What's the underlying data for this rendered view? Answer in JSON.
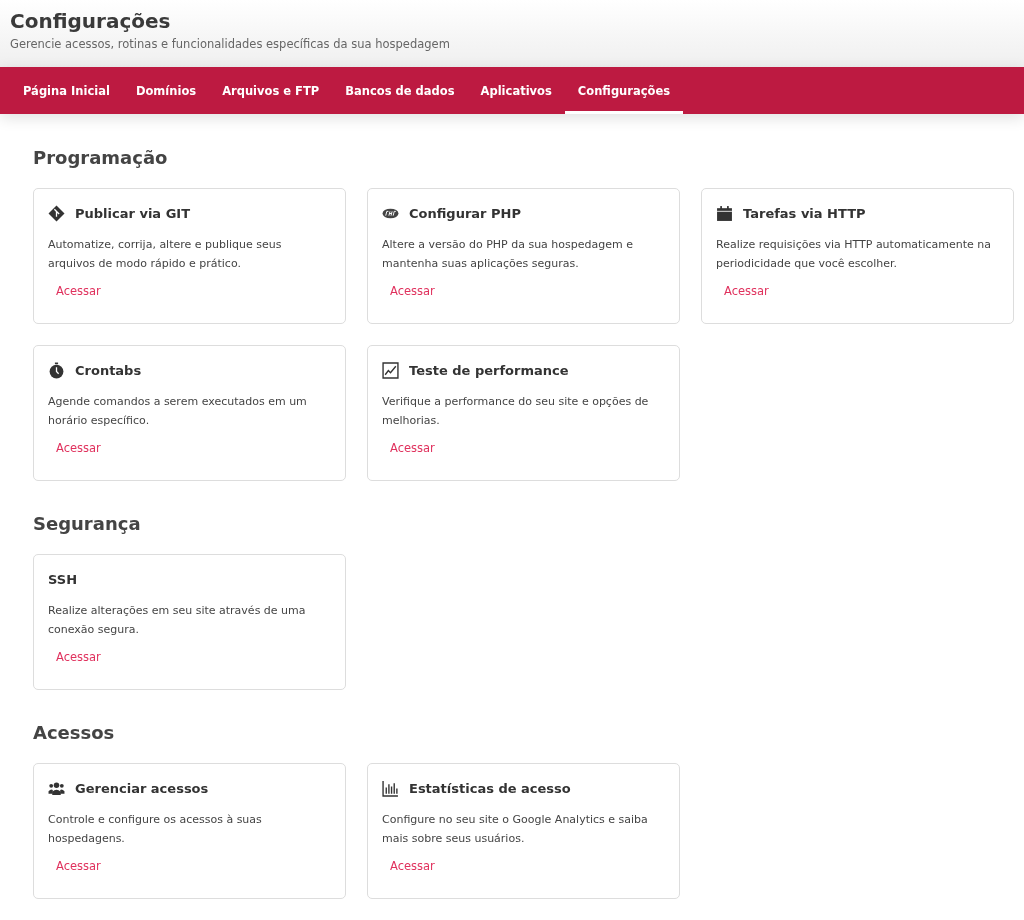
{
  "header": {
    "title": "Configurações",
    "subtitle": "Gerencie acessos, rotinas e funcionalidades específicas da sua hospedagem"
  },
  "tabs": [
    {
      "label": "Página Inicial",
      "selected": false
    },
    {
      "label": "Domínios",
      "selected": false
    },
    {
      "label": "Arquivos e FTP",
      "selected": false
    },
    {
      "label": "Bancos de dados",
      "selected": false
    },
    {
      "label": "Aplicativos",
      "selected": false
    },
    {
      "label": "Configurações",
      "selected": true
    }
  ],
  "sections": [
    {
      "title": "Programação",
      "cards": [
        {
          "kind": "git",
          "title": "Publicar via GIT",
          "description": "Automatize, corrija, altere e publique seus arquivos de modo rápido e prático.",
          "link": "Acessar"
        },
        {
          "kind": "php",
          "title": "Configurar PHP",
          "description": "Altere a versão do PHP da sua hospedagem e mantenha suas aplicações seguras.",
          "link": "Acessar"
        },
        {
          "kind": "calendar",
          "title": "Tarefas via HTTP",
          "description": "Realize requisições via HTTP automaticamente na periodicidade que você escolher.",
          "link": "Acessar"
        },
        {
          "kind": "stopwatch",
          "title": "Crontabs",
          "description": "Agende comandos a serem executados em um horário específico.",
          "link": "Acessar"
        },
        {
          "kind": "line-chart",
          "title": "Teste de performance",
          "description": "Verifique a performance do seu site e opções de melhorias.",
          "link": "Acessar"
        }
      ]
    },
    {
      "title": "Segurança",
      "cards": [
        {
          "kind": "plain",
          "title": "SSH",
          "description": "Realize alterações em seu site através de uma conexão segura.",
          "link": "Acessar"
        }
      ]
    },
    {
      "title": "Acessos",
      "cards": [
        {
          "kind": "users",
          "title": "Gerenciar acessos",
          "description": "Controle e configure os acessos à suas hospedagens.",
          "link": "Acessar"
        },
        {
          "kind": "bar-chart",
          "title": "Estatísticas de acesso",
          "description": "Configure no seu site o Google Analytics e saiba mais sobre seus usuários.",
          "link": "Acessar"
        }
      ]
    }
  ]
}
